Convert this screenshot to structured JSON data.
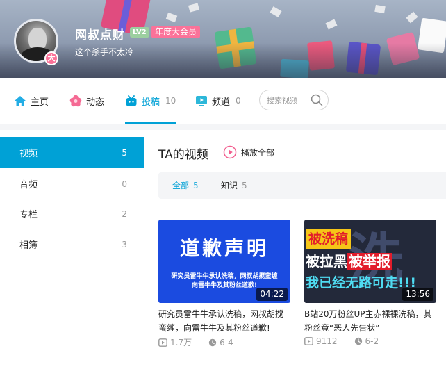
{
  "profile": {
    "username": "网叔点财",
    "level": "LV2",
    "vip_tag": "年度大会员",
    "vip_badge": "大",
    "signature": "这个杀手不太冷"
  },
  "nav": {
    "home": "主页",
    "dynamic": "动态",
    "uploads": "投稿",
    "uploads_count": "10",
    "channel": "频道",
    "channel_count": "0",
    "search_placeholder": "搜索视频"
  },
  "sidebar": {
    "items": [
      {
        "label": "视频",
        "count": "5"
      },
      {
        "label": "音频",
        "count": "0"
      },
      {
        "label": "专栏",
        "count": "2"
      },
      {
        "label": "相簿",
        "count": "3"
      }
    ]
  },
  "main": {
    "title": "TA的视频",
    "play_all": "播放全部",
    "filters": [
      {
        "label": "全部",
        "count": "5"
      },
      {
        "label": "知识",
        "count": "5"
      }
    ]
  },
  "videos": [
    {
      "thumb_big": "道歉声明",
      "thumb_small_1": "研究员雷牛牛承认洗稿，网叔胡搅蛮缠",
      "thumb_small_2": "向雷牛牛及其粉丝道歉!",
      "duration": "04:22",
      "title": "研究员雷牛牛承认洗稿，网叔胡搅蛮缠，向雷牛牛及其粉丝道歉!",
      "views": "1.7万",
      "date": "6-4"
    },
    {
      "thumb_bg": "洗稿",
      "thumb_line1": "被洗稿",
      "thumb_line2a": "被拉黑",
      "thumb_line2b": "被举报",
      "thumb_line3": "我已经无路可走!!!",
      "duration": "13:56",
      "title": "B站20万粉丝UP主赤裸裸洗稿，其粉丝竟“恶人先告状”",
      "views": "9112",
      "date": "6-2"
    }
  ],
  "colors": {
    "accent": "#00a1d6",
    "vip_pink": "#fb7299",
    "level_green": "#9ccfa0"
  }
}
